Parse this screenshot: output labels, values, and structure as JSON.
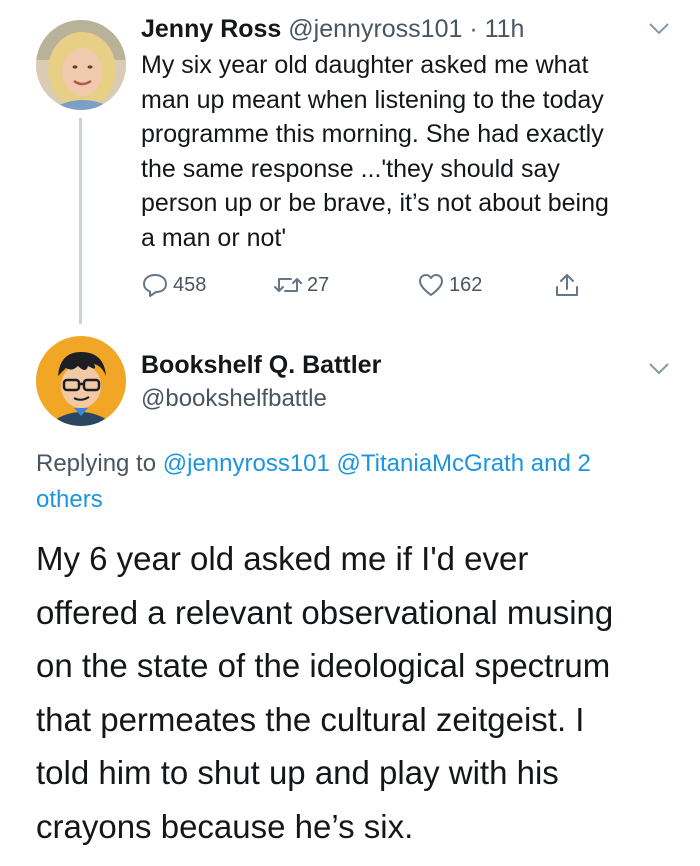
{
  "tweet1": {
    "name": "Jenny Ross",
    "handle": "@jennyross101",
    "separator": " · ",
    "time": "11h",
    "body_lines": [
      "My six year old daughter asked me what",
      "man up meant when listening to the today",
      "programme this morning. She had exactly",
      "the same response ...'they should say",
      "person up or be brave, it’s not about being",
      "a man or not'"
    ],
    "actions": {
      "replies": "458",
      "retweets": "27",
      "likes": "162"
    },
    "icons": [
      "avatar",
      "chevron-down-icon",
      "reply-icon",
      "retweet-icon",
      "like-icon",
      "share-icon"
    ]
  },
  "tweet2": {
    "name": "Bookshelf Q. Battler",
    "handle": "@bookshelfbattle",
    "replying_prefix": "Replying to ",
    "replying_mention1": "@jennyross101",
    "replying_mention2": "@TitaniaMcGrath",
    "replying_suffix_and": " and 2",
    "replying_others": "others",
    "body_lines": [
      "My 6 year old asked me if I'd ever",
      "offered a relevant observational musing",
      "on the state of the ideological spectrum",
      "that permeates the cultural zeitgeist. I",
      "told him to shut up and play with his",
      "crayons because he’s six."
    ]
  },
  "colors": {
    "text": "#14171a",
    "secondary": "#4a5560",
    "link": "#1b95e0",
    "thread_line": "#c8d2dc"
  }
}
